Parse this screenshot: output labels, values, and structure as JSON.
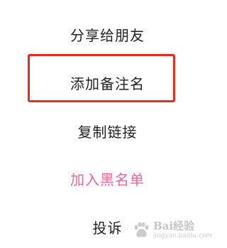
{
  "menu": {
    "items": [
      {
        "label": "分享给朋友"
      },
      {
        "label": "添加备注名"
      },
      {
        "label": "复制链接"
      },
      {
        "label": "加入黑名单"
      },
      {
        "label": "投诉"
      }
    ]
  },
  "colors": {
    "text": "#222222",
    "danger_text": "#e7679a",
    "highlight_border": "#e02e24",
    "background": "#ffffff"
  },
  "watermark": {
    "brand": "Bai经验",
    "url": "jingyan.baidu.com"
  }
}
